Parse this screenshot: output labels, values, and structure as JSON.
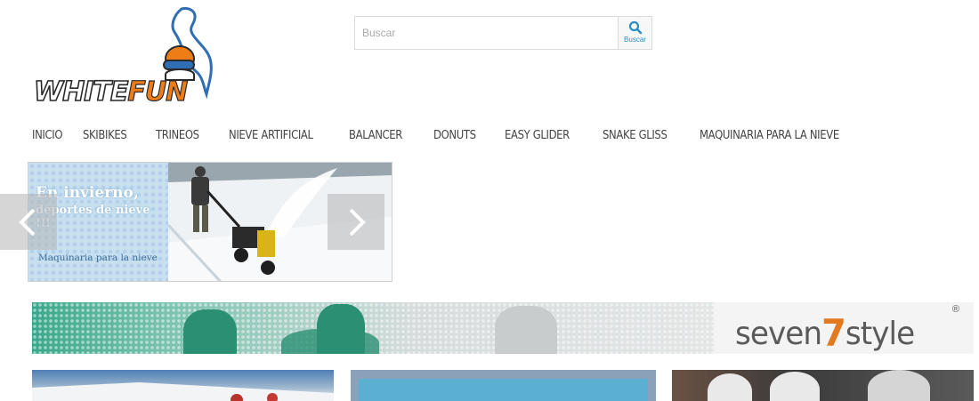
{
  "logo": {
    "text_part1": "WHITE",
    "text_part2": "FUN",
    "accent": "#ef7d17",
    "ink": "#2a2a2a",
    "map_blue": "#2f6db5"
  },
  "search": {
    "placeholder": "Buscar",
    "button_label": "Buscar",
    "icon": "search-icon",
    "accent": "#2a8fc7"
  },
  "nav": {
    "items": [
      {
        "label": "INICIO"
      },
      {
        "label": "SKIBIKES"
      },
      {
        "label": "TRINEOS"
      },
      {
        "label": "NIEVE ARTIFICIAL"
      },
      {
        "label": "BALANCER"
      },
      {
        "label": "DONUTS"
      },
      {
        "label": "EASY GLIDER"
      },
      {
        "label": "SNAKE GLISS"
      },
      {
        "label": "MAQUINARIA PARA LA NIEVE"
      }
    ]
  },
  "slider": {
    "headline_1": "En invierno,",
    "headline_2": "deportes de nieve !!!",
    "caption": "Maquinaria para la nieve",
    "prev_icon": "chevron-left-icon",
    "next_icon": "chevron-right-icon"
  },
  "banner": {
    "brand_part1": "seven",
    "brand_mark": "7",
    "brand_part2": "style",
    "registered": "®",
    "brand_accent": "#e37a20"
  }
}
